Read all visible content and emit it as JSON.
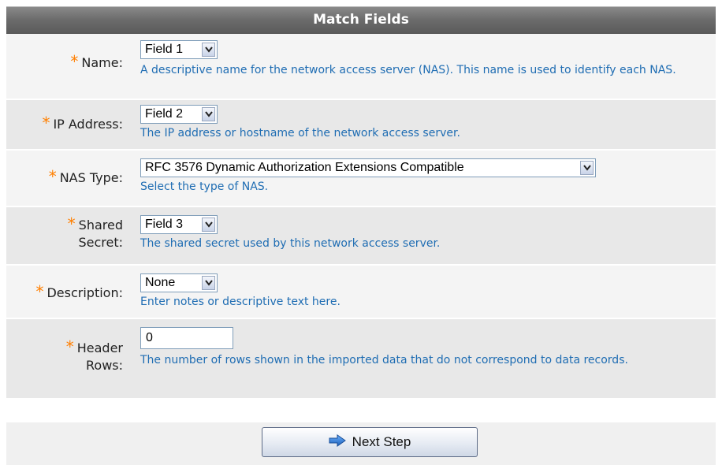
{
  "panel": {
    "title": "Match Fields"
  },
  "rows": [
    {
      "label": "Name:",
      "value": "Field 1",
      "help": "A descriptive name for the network access server (NAS). This name is used to identify each NAS."
    },
    {
      "label": "IP Address:",
      "value": "Field 2",
      "help": "The IP address or hostname of the network access server."
    },
    {
      "label": "NAS Type:",
      "value": "RFC 3576 Dynamic Authorization Extensions Compatible",
      "help": "Select the type of NAS."
    },
    {
      "label_line1": "Shared",
      "label_line2": "Secret:",
      "value": "Field 3",
      "help": "The shared secret used by this network access server."
    },
    {
      "label": "Description:",
      "value": "None",
      "help": "Enter notes or descriptive text here."
    },
    {
      "label_line1": "Header",
      "label_line2": "Rows:",
      "value": "0",
      "help": "The number of rows shown in the imported data that do not correspond to data records."
    }
  ],
  "required_marker": "*",
  "footer": {
    "next_label": "Next Step"
  },
  "icons": {
    "dropdown": "chevron-down-icon",
    "next": "arrow-right-icon"
  },
  "colors": {
    "required": "#ff7f00",
    "help_text": "#1f6db3",
    "header_bg": "#6c6c6c"
  }
}
